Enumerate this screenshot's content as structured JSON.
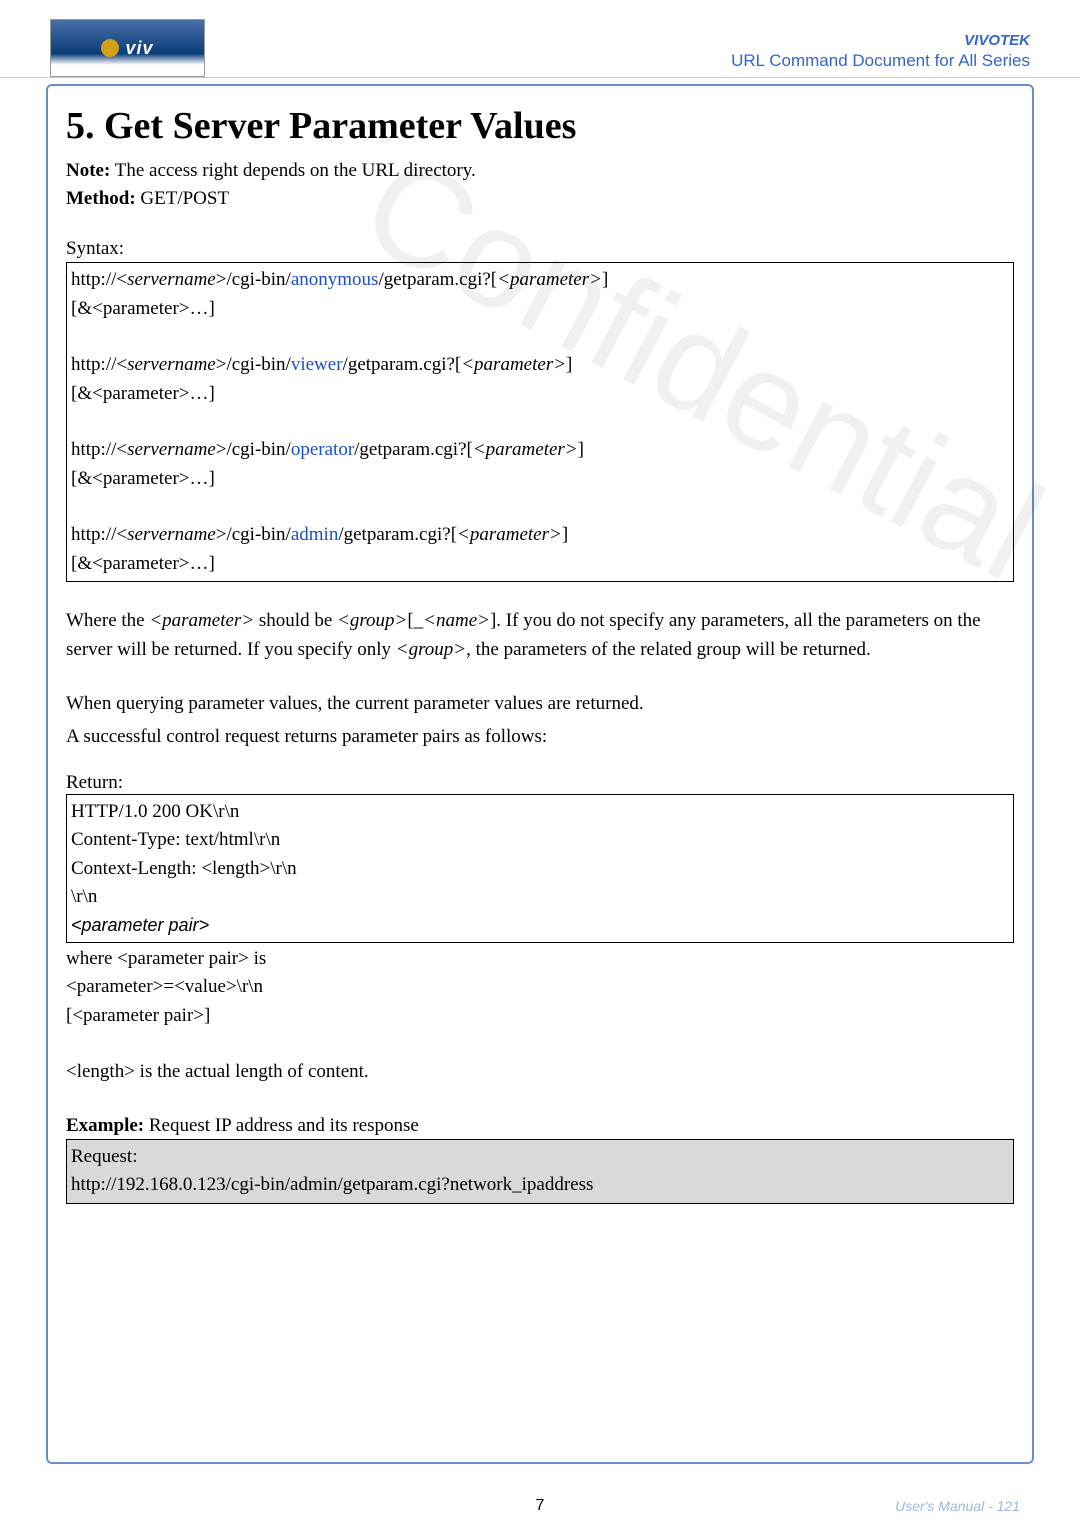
{
  "header": {
    "brand": "VIVOTEK",
    "subtitle": "URL Command Document for All Series",
    "logo_text": "viv"
  },
  "title": "5. Get Server Parameter Values",
  "note_label": "Note:",
  "note_text": " The access right depends on the URL directory.",
  "method_label": "Method:",
  "method_value": " GET/POST",
  "syntax_label": "Syntax:",
  "syntax_box": {
    "l1a": "http://<",
    "l1b": "servername",
    "l1c": ">/cgi-bin/",
    "l1d": "anonymous",
    "l1e": "/getparam.cgi?[",
    "l1f": "<parameter>",
    "l1g": "]",
    "l2": "[&<parameter>…]",
    "l3a": "http://<",
    "l3b": "servername",
    "l3c": ">/cgi-bin/",
    "l3d": "viewer",
    "l3e": "/getparam.cgi?[",
    "l3f": "<parameter>",
    "l3g": "]",
    "l4": "[&<parameter>…]",
    "l5a": "http://<",
    "l5b": "servername",
    "l5c": ">/cgi-bin/",
    "l5d": "operator",
    "l5e": "/getparam.cgi?[",
    "l5f": "<parameter>",
    "l5g": "]",
    "l6": "[&<parameter>…]",
    "l7a": "http://<",
    "l7b": "servername",
    "l7c": ">/cgi-bin/",
    "l7d": "admin",
    "l7e": "/getparam.cgi?[",
    "l7f": "<parameter>",
    "l7g": "]",
    "l8": "[&<parameter>…]"
  },
  "body": {
    "p1a": "Where the ",
    "p1b": "<parameter>",
    "p1c": " should be ",
    "p1d": "<group>",
    "p1e": "[_",
    "p1f": "<name>",
    "p1g": "]. If you do not specify any parameters, all the parameters on the server will be returned. If you specify only ",
    "p1h": "<group>",
    "p1i": ", the parameters of the related group will be returned.",
    "p2": "When querying parameter values, the current parameter values are returned.",
    "p3": "A successful control request returns parameter pairs as follows:"
  },
  "return_label": "Return:",
  "return_box": {
    "l1": "HTTP/1.0 200 OK\\r\\n",
    "l2": "Content-Type: text/html\\r\\n",
    "l3": "Context-Length: <length>\\r\\n",
    "l4": "\\r\\n",
    "l5": "<parameter pair>"
  },
  "after_box": {
    "l1": "where <parameter pair> is",
    "l2": "<parameter>=<value>\\r\\n",
    "l3": "[<parameter pair>]",
    "l4": "<length> is the actual length of content."
  },
  "example_label": "Example:",
  "example_text": " Request IP address and its response",
  "example_box": {
    "l1": "Request:",
    "l2": "http://192.168.0.123/cgi-bin/admin/getparam.cgi?network_ipaddress"
  },
  "footer": {
    "page": "7",
    "manual": "User's Manual - 121"
  },
  "watermark": "Confidential"
}
